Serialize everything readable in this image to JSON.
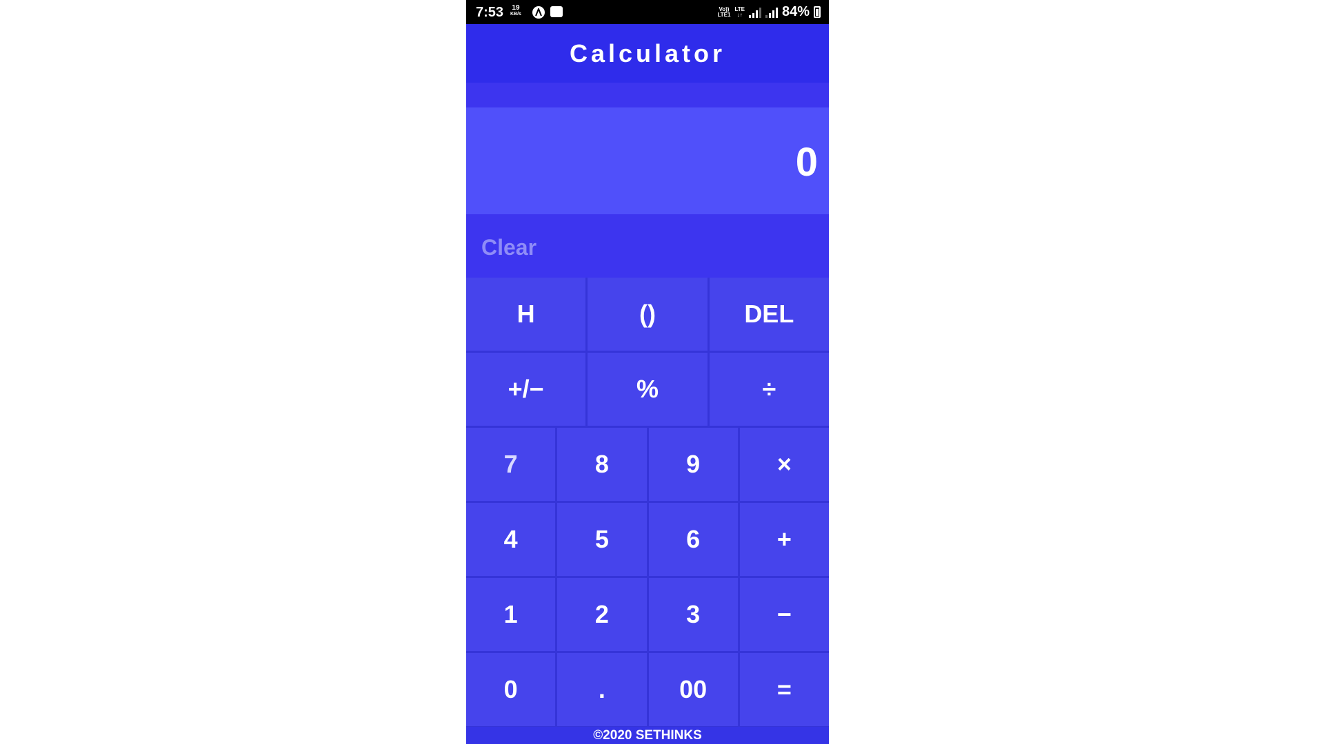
{
  "status_bar": {
    "time": "7:53",
    "net_speed_value": "19",
    "net_speed_unit": "KB/s",
    "volte_top": "Vo))",
    "volte_bottom": "LTE1",
    "lte_label": "LTE",
    "battery_percent": "84%"
  },
  "app_bar": {
    "title": "Calculator"
  },
  "display": {
    "value": "0"
  },
  "actions": {
    "clear_label": "Clear"
  },
  "keypad": {
    "rows": [
      [
        "H",
        "()",
        "DEL"
      ],
      [
        "+/−",
        "%",
        "÷"
      ],
      [
        "7",
        "8",
        "9",
        "×"
      ],
      [
        "4",
        "5",
        "6",
        "+"
      ],
      [
        "1",
        "2",
        "3",
        "−"
      ],
      [
        "0",
        ".",
        "00",
        "="
      ]
    ]
  },
  "footer": {
    "copyright": "©2020 SETHINKS"
  },
  "colors": {
    "accent": "#3d35ef",
    "app_bar": "#2f2ceb",
    "display_bg": "#5050fa",
    "key_bg": "#4644ec",
    "clear_text": "#8f8cf7"
  }
}
